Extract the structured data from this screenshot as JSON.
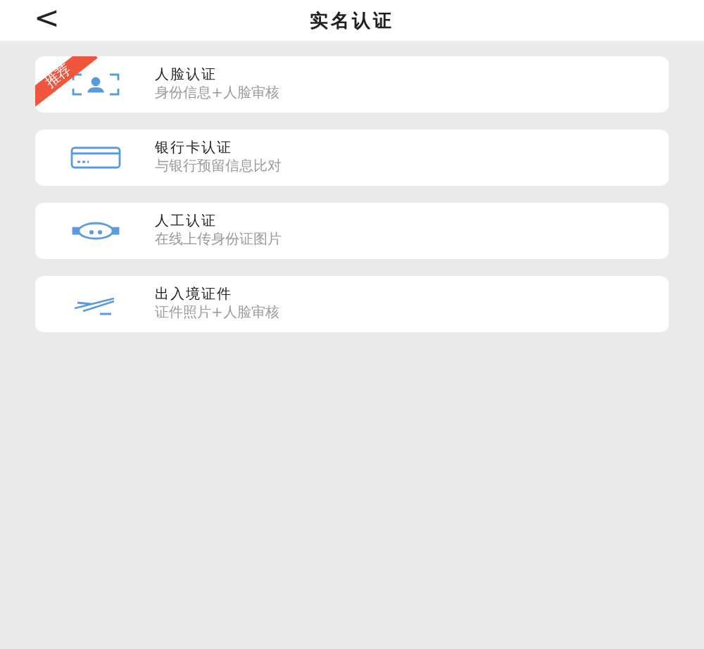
{
  "header": {
    "back": "<",
    "title": "实名认证"
  },
  "options": [
    {
      "kind": "face",
      "title": "人脸认证",
      "subtitle": "身份信息+人脸审核",
      "badge": "推荐"
    },
    {
      "kind": "card",
      "title": "银行卡认证",
      "subtitle": "与银行预留信息比对"
    },
    {
      "kind": "agent",
      "title": "人工认证",
      "subtitle": "在线上传身份证图片"
    },
    {
      "kind": "plane",
      "title": "出入境证件",
      "subtitle": "证件照片+人脸审核"
    }
  ]
}
